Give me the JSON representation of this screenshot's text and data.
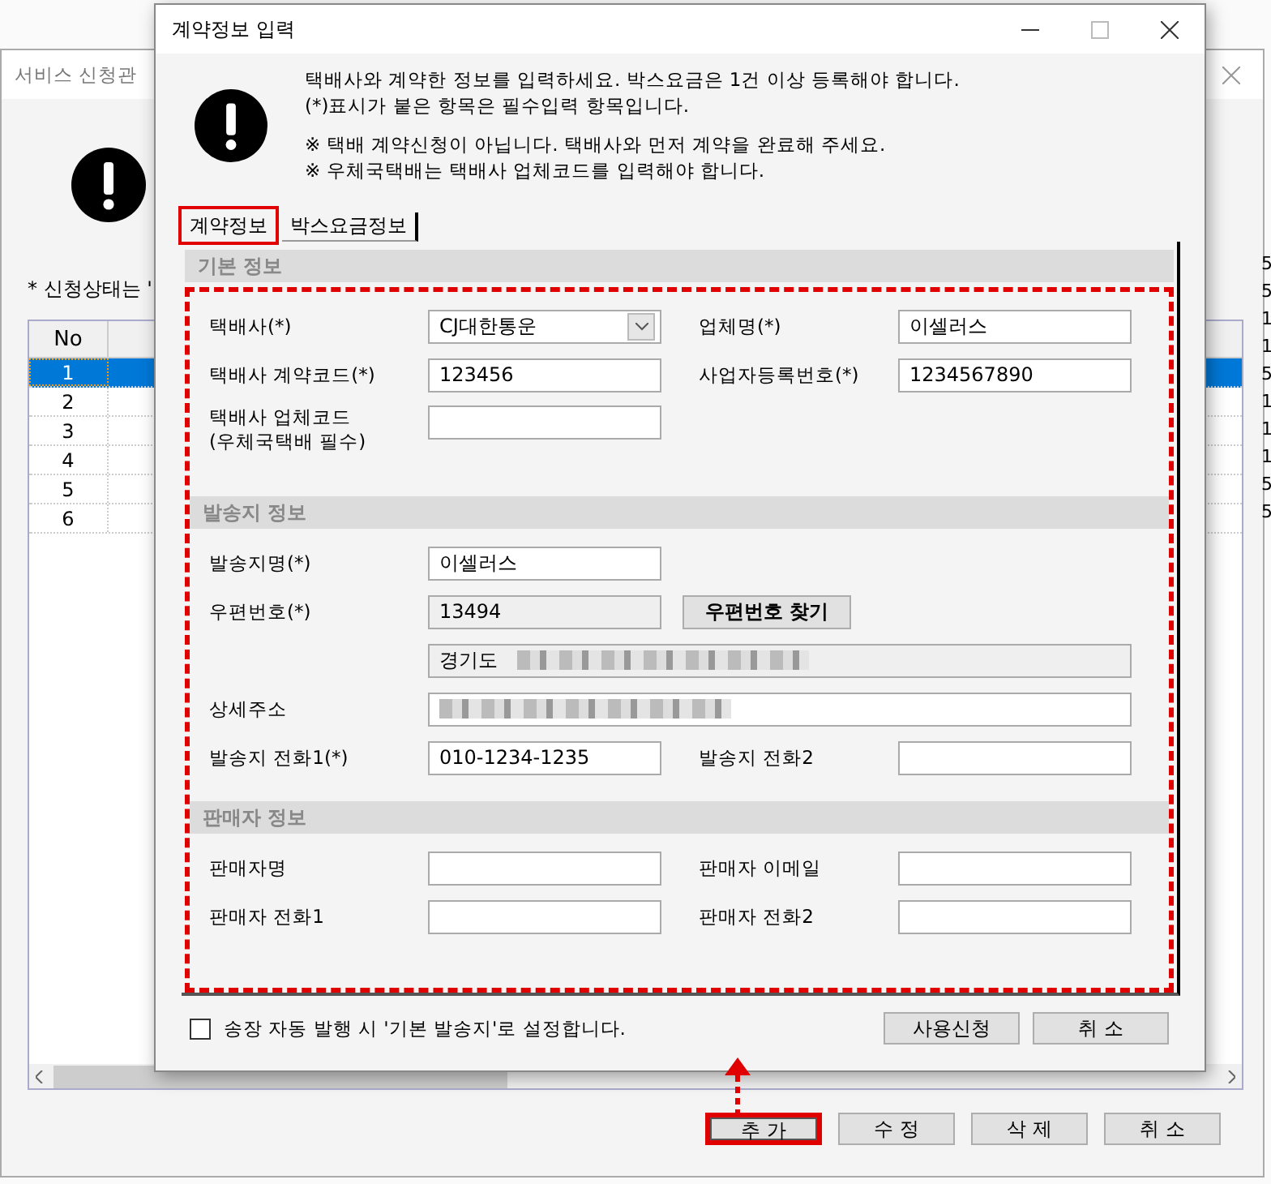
{
  "background_window": {
    "title": "서비스 신청관",
    "note": "* 신청상태는 '",
    "table": {
      "columns": [
        "No"
      ],
      "rows": [
        {
          "no": "1",
          "selected": true
        },
        {
          "no": "2",
          "selected": false
        },
        {
          "no": "3",
          "selected": false
        },
        {
          "no": "4",
          "selected": false
        },
        {
          "no": "5",
          "selected": false
        },
        {
          "no": "6",
          "selected": false
        }
      ]
    },
    "buttons": [
      {
        "label": "추 가",
        "highlighted": true
      },
      {
        "label": "수 정",
        "highlighted": false
      },
      {
        "label": "삭 제",
        "highlighted": false
      },
      {
        "label": "취 소",
        "highlighted": false
      }
    ]
  },
  "edge_column": [
    "5",
    "5",
    "1",
    "1",
    "5",
    "1",
    "1",
    "1",
    "5",
    "5"
  ],
  "dialog": {
    "title": "계약정보 입력",
    "message": [
      "택배사와 계약한 정보를 입력하세요. 박스요금은 1건 이상 등록해야 합니다.",
      "(*)표시가 붙은 항목은 필수입력 항목입니다."
    ],
    "notes": [
      "※ 택배 계약신청이 아닙니다. 택배사와 먼저 계약을 완료해 주세요.",
      "※ 우체국택배는 택배사 업체코드를 입력해야 합니다."
    ],
    "tabs": [
      {
        "label": "계약정보",
        "selected": true,
        "highlighted": true
      },
      {
        "label": "박스요금정보",
        "selected": false,
        "highlighted": false
      }
    ],
    "sections": [
      {
        "title": "기본 정보",
        "rows": [
          [
            {
              "kind": "select",
              "label": "택배사(*)",
              "value": "CJ대한통운"
            },
            {
              "kind": "text",
              "label": "업체명(*)",
              "value": "이셀러스"
            }
          ],
          [
            {
              "kind": "text",
              "label": "택배사 계약코드(*)",
              "value": "123456"
            },
            {
              "kind": "text",
              "label": "사업자등록번호(*)",
              "value": "1234567890"
            }
          ],
          [
            {
              "kind": "text",
              "label": "택배사 업체코드\n(우체국택배 필수)"
            }
          ]
        ]
      },
      {
        "title": "발송지 정보",
        "rows": [
          [
            {
              "kind": "text",
              "label": "발송지명(*)",
              "value": "이셀러스"
            }
          ],
          [
            {
              "kind": "readonly",
              "label": "우편번호(*)",
              "value": "13494"
            },
            {
              "kind": "button",
              "label": "우편번호 찾기"
            }
          ],
          [
            {
              "kind": "wide-readonly",
              "value": "경기도",
              "blurred": true
            }
          ],
          [
            {
              "kind": "wide-text",
              "label": "상세주소",
              "blurred": true
            }
          ],
          [
            {
              "kind": "text",
              "label": "발송지 전화1(*)",
              "value": "010-1234-1235"
            },
            {
              "kind": "text",
              "label": "발송지 전화2"
            }
          ]
        ]
      },
      {
        "title": "판매자 정보",
        "rows": [
          [
            {
              "kind": "text",
              "label": "판매자명"
            },
            {
              "kind": "text",
              "label": "판매자 이메일"
            }
          ],
          [
            {
              "kind": "text",
              "label": "판매자 전화1"
            },
            {
              "kind": "text",
              "label": "판매자 전화2"
            }
          ]
        ]
      }
    ],
    "checkbox": {
      "label": "송장 자동 발행 시 '기본 발송지'로 설정합니다.",
      "checked": false
    },
    "buttons": [
      "사용신청",
      "취 소"
    ]
  }
}
